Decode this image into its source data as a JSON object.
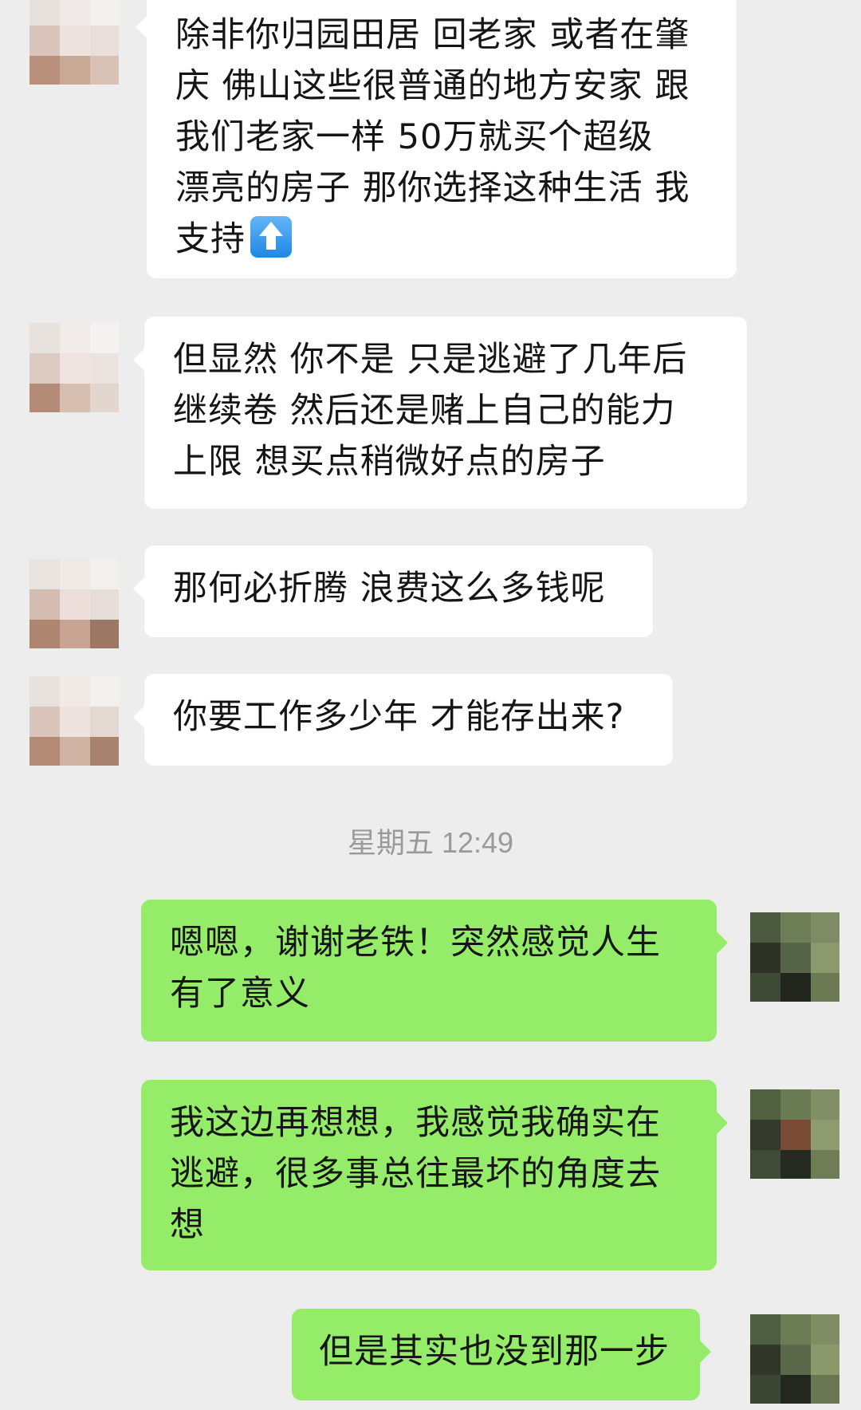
{
  "chat": {
    "timestamp": "星期五 12:49",
    "messages": [
      {
        "side": "received",
        "lines": [
          "除非你归园田居 回老家 或者在肇",
          "庆 佛山这些很普通的地方安家 跟",
          "我们老家一样  50万就买个超级",
          "漂亮的房子 那你选择这种生活 我",
          "支持"
        ],
        "emoji": "up-arrow-icon"
      },
      {
        "side": "received",
        "lines": [
          "但显然 你不是 只是逃避了几年后",
          "继续卷 然后还是赌上自己的能力",
          "上限 想买点稍微好点的房子"
        ]
      },
      {
        "side": "received",
        "lines": [
          "那何必折腾 浪费这么多钱呢"
        ]
      },
      {
        "side": "received",
        "lines": [
          "你要工作多少年 才能存出来?"
        ]
      },
      {
        "side": "sent",
        "lines": [
          "嗯嗯，谢谢老铁！突然感觉人生",
          "有了意义"
        ]
      },
      {
        "side": "sent",
        "lines": [
          "我这边再想想，我感觉我确实在",
          "逃避，很多事总往最坏的角度去",
          "想"
        ]
      },
      {
        "side": "sent",
        "lines": [
          "但是其实也没到那一步"
        ]
      }
    ]
  },
  "colors": {
    "background": "#ededed",
    "received_bubble": "#ffffff",
    "sent_bubble": "#95ec69",
    "timestamp_text": "#9a9a9a"
  }
}
